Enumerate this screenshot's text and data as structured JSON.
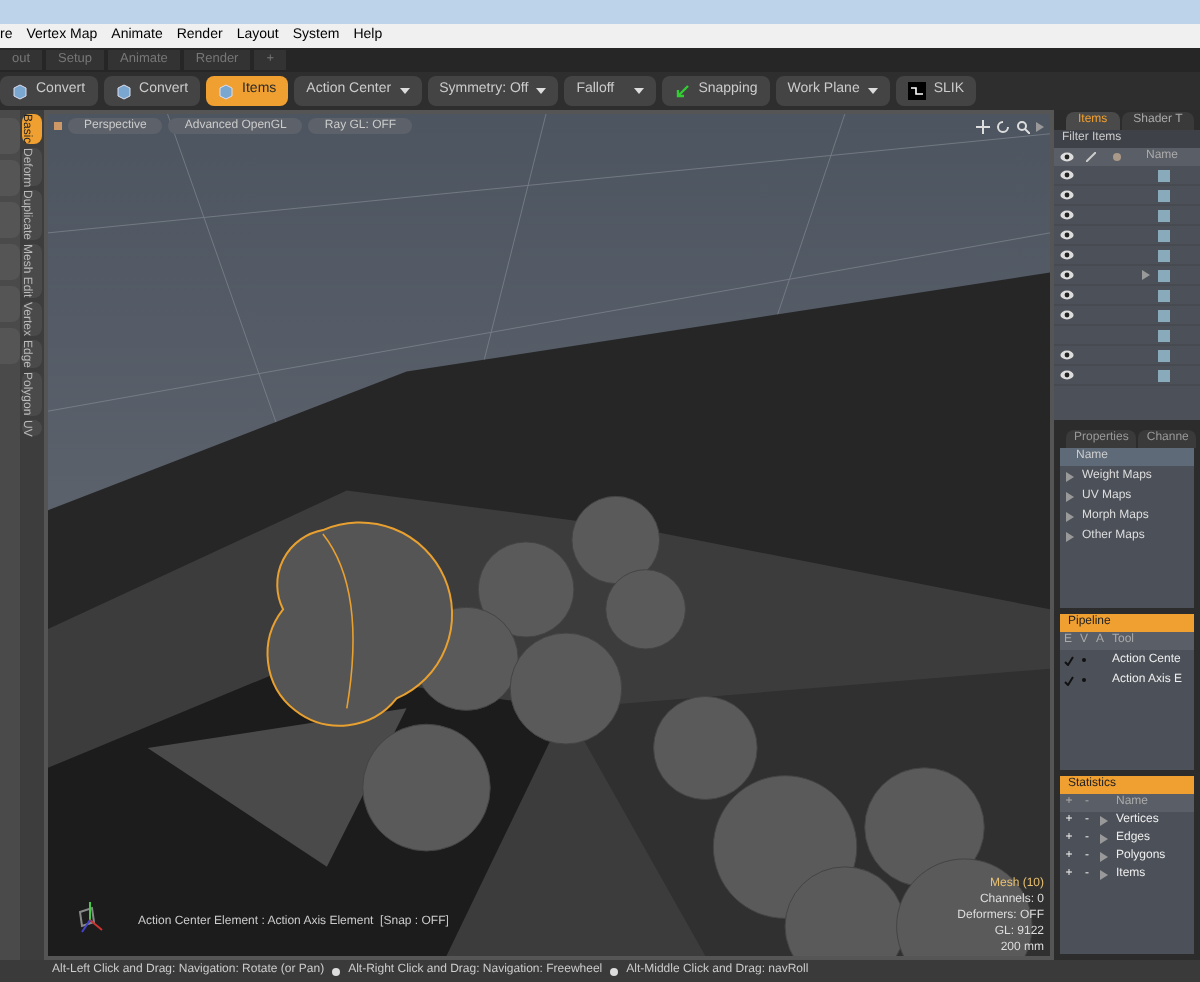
{
  "menu": [
    "re",
    "Vertex Map",
    "Animate",
    "Render",
    "Layout",
    "System",
    "Help"
  ],
  "layout_tabs": [
    {
      "label": "out",
      "selected": false
    },
    {
      "label": "Setup",
      "selected": false
    },
    {
      "label": "Animate",
      "selected": false
    },
    {
      "label": "Render",
      "selected": false
    },
    {
      "label": "+",
      "selected": false
    }
  ],
  "toolbar": [
    {
      "kind": "tool",
      "label": "Convert",
      "selected": false
    },
    {
      "kind": "tool",
      "label": "Convert",
      "selected": false
    },
    {
      "kind": "tool",
      "label": "Items",
      "selected": true
    },
    {
      "kind": "dropdown",
      "label": "Action Center"
    },
    {
      "kind": "dropdown",
      "label": "Symmetry: Off"
    },
    {
      "kind": "dropdown",
      "label": "Falloff"
    },
    {
      "kind": "snap",
      "label": "Snapping"
    },
    {
      "kind": "dropdown",
      "label": "Work Plane"
    },
    {
      "kind": "slik",
      "label": "SLIK"
    }
  ],
  "tool_tabs": [
    {
      "label": "Basic",
      "selected": true
    },
    {
      "label": "Deform",
      "selected": false
    },
    {
      "label": "Duplicate",
      "selected": false
    },
    {
      "label": "Mesh Edit",
      "selected": false
    },
    {
      "label": "Vertex",
      "selected": false
    },
    {
      "label": "Edge",
      "selected": false
    },
    {
      "label": "Polygon",
      "selected": false
    },
    {
      "label": "UV",
      "selected": false
    }
  ],
  "viewport": {
    "buttons": [
      "Perspective",
      "Advanced OpenGL",
      "Ray GL: OFF"
    ],
    "info": "Action Center Element : Action Axis Element  [Snap : OFF]",
    "stats": {
      "title": "Mesh (10)",
      "lines": [
        "Channels: 0",
        "Deformers: OFF",
        "GL: 9122",
        "200 mm"
      ]
    }
  },
  "items_panel": {
    "tabs": [
      {
        "label": "Items",
        "selected": true
      },
      {
        "label": "Shader T",
        "selected": false
      }
    ],
    "filter": "Filter Items",
    "name_header": "Name",
    "rows": [
      {
        "visible": true,
        "expandable": false
      },
      {
        "visible": true,
        "expandable": false
      },
      {
        "visible": true,
        "expandable": false
      },
      {
        "visible": true,
        "expandable": false
      },
      {
        "visible": true,
        "expandable": false
      },
      {
        "visible": true,
        "expandable": true
      },
      {
        "visible": true,
        "expandable": false
      },
      {
        "visible": true,
        "expandable": false
      },
      {
        "visible": false,
        "expandable": false
      },
      {
        "visible": true,
        "expandable": false
      },
      {
        "visible": true,
        "expandable": false
      }
    ]
  },
  "properties_panel": {
    "tabs": [
      {
        "label": "Properties",
        "selected": false
      },
      {
        "label": "Channe",
        "selected": false
      }
    ],
    "header": "Name",
    "rows": [
      "Weight Maps",
      "UV Maps",
      "Morph Maps",
      "Other Maps"
    ]
  },
  "pipeline": {
    "title": "Pipeline",
    "columns": [
      "E",
      "V",
      "A",
      "Tool"
    ],
    "rows": [
      {
        "enabled": true,
        "label": "Action Cente"
      },
      {
        "enabled": true,
        "label": "Action Axis E"
      }
    ]
  },
  "statistics": {
    "title": "Statistics",
    "columns": [
      "+",
      "-",
      "Name"
    ],
    "rows": [
      {
        "plus": "+",
        "minus": "-",
        "label": "Vertices"
      },
      {
        "plus": "+",
        "minus": "-",
        "label": "Edges"
      },
      {
        "plus": "+",
        "minus": "-",
        "label": "Polygons"
      },
      {
        "plus": "+",
        "minus": "-",
        "label": "Items"
      }
    ]
  },
  "status_hints": [
    "Alt-Left Click and Drag: Navigation: Rotate (or Pan)",
    "Alt-Right Click and Drag: Navigation: Freewheel",
    "Alt-Middle Click and Drag: navRoll"
  ]
}
